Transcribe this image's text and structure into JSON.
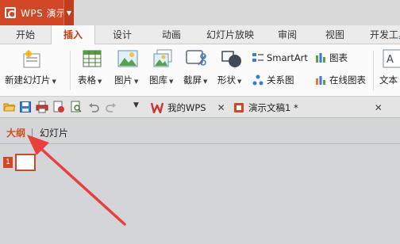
{
  "app": {
    "name": "WPS 演示"
  },
  "tabs": [
    "开始",
    "插入",
    "设计",
    "动画",
    "幻灯片放映",
    "审阅",
    "视图",
    "开发工具"
  ],
  "active_tab": "插入",
  "ribbon": {
    "new_slide": "新建幻灯片",
    "table": "表格",
    "picture": "图片",
    "gallery": "图库",
    "screenshot": "截屏",
    "shape": "形状",
    "smartart": "SmartArt",
    "chart": "图表",
    "relation": "关系图",
    "online_chart": "在线图表",
    "textbox": "文本"
  },
  "doc_tabs": {
    "mywps": "我的WPS",
    "doc1": "演示文稿1 *"
  },
  "outline_tabs": {
    "outline": "大纲",
    "slides": "幻灯片"
  },
  "slide": {
    "number": "1"
  },
  "colors": {
    "brand": "#d24726",
    "active_tab_text": "#c4390f",
    "arrow": "#e8403c"
  }
}
